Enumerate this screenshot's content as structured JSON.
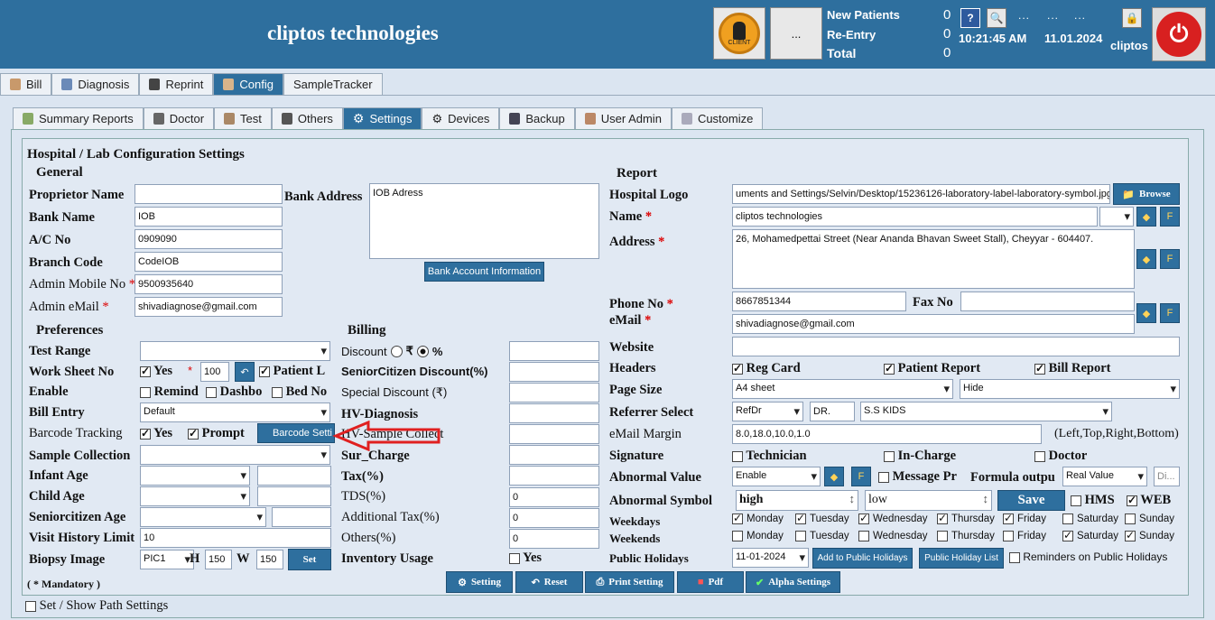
{
  "header": {
    "app_name": "cliptos technologies",
    "client_label": "CLIENT",
    "more": "...",
    "new_patients_label": "New Patients",
    "new_patients": "0",
    "reentry_label": "Re-Entry",
    "reentry": "0",
    "total_label": "Total",
    "total": "0",
    "help": "?",
    "dots1": "...",
    "dots2": "...",
    "dots3": "...",
    "time": "10:21:45 AM",
    "date": "11.01.2024",
    "user": "cliptos"
  },
  "main_tabs": [
    "Bill",
    "Diagnosis",
    "Reprint",
    "Config",
    "SampleTracker"
  ],
  "sub_tabs": [
    "Summary Reports",
    "Doctor",
    "Test",
    "Others",
    "Settings",
    "Devices",
    "Backup",
    "User Admin",
    "Customize"
  ],
  "panel_title": "Hospital / Lab Configuration Settings",
  "general": {
    "title": "General",
    "proprietor_label": "Proprietor Name",
    "proprietor": "",
    "bank_address_label": "Bank Address",
    "bank_address": "IOB Adress",
    "bank_name_label": "Bank Name",
    "bank_name": "IOB",
    "acno_label": "A/C No",
    "acno": "0909090",
    "branch_label": "Branch Code",
    "branch": "CodeIOB",
    "mobile_label": "Admin Mobile No",
    "mobile": "9500935640",
    "email_label": "Admin eMail",
    "email": "shivadiagnose@gmail.com",
    "bank_info_button": "Bank Account Information",
    "star": "*"
  },
  "preferences": {
    "title": "Preferences",
    "test_range": "Test Range",
    "worksheet": "Work Sheet No",
    "yes": "Yes",
    "worksheet_value": "100",
    "patient_l": "Patient L",
    "enable": "Enable",
    "remind": "Remind",
    "dashbo": "Dashbo",
    "bed": "Bed No",
    "bill_entry": "Bill Entry",
    "bill_entry_value": "Default",
    "barcode": "Barcode Tracking",
    "prompt": "Prompt",
    "barcode_btn": "Barcode Setti",
    "sample_collection": "Sample Collection",
    "infant_age": "Infant Age",
    "child_age": "Child Age",
    "senior_age": "Seniorcitizen Age",
    "visit_history": "Visit History Limit",
    "visit_history_value": "10",
    "biopsy": "Biopsy Image",
    "biopsy_value": "PIC1",
    "h": "H",
    "h_value": "150",
    "w": "W",
    "w_value": "150",
    "set": "Set",
    "mandatory": "( * Mandatory )"
  },
  "billing": {
    "title": "Billing",
    "discount": "Discount",
    "rupee": "₹",
    "percent": "%",
    "senior_discount": "SeniorCitizen Discount(%)",
    "special_discount": "Special Discount (₹)",
    "hv_diagnosis": "HV-Diagnosis",
    "hv_sample": "HV-Sample Collect",
    "sur_charge": "Sur_Charge",
    "tax": "Tax(%)",
    "tds": "TDS(%)",
    "tds_value": "0",
    "add_tax": "Additional Tax(%)",
    "add_tax_value": "0",
    "others": "Others(%)",
    "others_value": "0",
    "inventory": "Inventory Usage",
    "inventory_yes": "Yes"
  },
  "report": {
    "title": "Report",
    "logo_label": "Hospital Logo",
    "logo_path": "uments and Settings/Selvin/Desktop/15236126-laboratory-label-laboratory-symbol.jpg",
    "browse": "Browse",
    "name_label": "Name",
    "name": "cliptos technologies",
    "address_label": "Address",
    "address": "26, Mohamedpettai Street (Near Ananda Bhavan Sweet Stall), Cheyyar - 604407.",
    "phone_label": "Phone No",
    "phone": "8667851344",
    "fax_label": "Fax No",
    "fax": "",
    "email_label": "eMail",
    "email": "shivadiagnose@gmail.com",
    "website_label": "Website",
    "website": "",
    "headers_label": "Headers",
    "reg_card": "Reg Card",
    "patient_report": "Patient Report",
    "bill_report": "Bill Report",
    "page_size_label": "Page Size",
    "page_size": "A4 sheet",
    "hide": "Hide",
    "referrer_label": "Referrer Select",
    "refdr": "RefDr",
    "dr": "DR.",
    "sskids": "S.S KIDS",
    "margin_label": "eMail Margin",
    "margin": "8.0,18.0,10.0,1.0",
    "margin_hint": "(Left,Top,Right,Bottom)",
    "signature_label": "Signature",
    "technician": "Technician",
    "incharge": "In-Charge",
    "doctor": "Doctor",
    "abnormal_label": "Abnormal Value",
    "abnormal_value": "Enable",
    "message": "Message Pr",
    "formula": "Formula outpu",
    "formula_value": "Real Value",
    "di": "Di...",
    "symbol_label": "Abnormal Symbol",
    "high": "high",
    "low": "low",
    "save": "Save",
    "hms": "HMS",
    "web": "WEB",
    "weekdays_label": "Weekdays",
    "weekends_label": "Weekends",
    "days": [
      "Monday",
      "Tuesday",
      "Wednesday",
      "Thursday",
      "Friday",
      "Saturday",
      "Sunday"
    ],
    "holidays_label": "Public Holidays",
    "holiday_date": "11-01-2024",
    "add_holiday": "Add to Public Holidays",
    "holiday_list": "Public Holiday List",
    "reminders": "Reminders on Public Holidays"
  },
  "bottom_buttons": [
    "Setting",
    "Reset",
    "Print Setting",
    "Pdf",
    "Alpha Settings"
  ],
  "path_settings": "Set / Show Path Settings"
}
